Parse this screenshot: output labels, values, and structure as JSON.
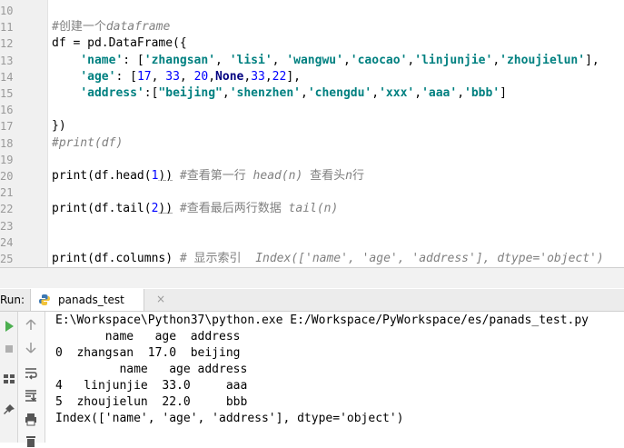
{
  "editor": {
    "lines": [
      {
        "n": "10",
        "segs": []
      },
      {
        "n": "11",
        "segs": [
          {
            "t": "#创建一个",
            "c": "cmn"
          },
          {
            "t": "dataframe",
            "c": "cm"
          }
        ]
      },
      {
        "n": "12",
        "segs": [
          {
            "t": "df = pd.DataFrame({",
            "c": ""
          }
        ]
      },
      {
        "n": "13",
        "segs": [
          {
            "t": "    ",
            "c": ""
          },
          {
            "t": "'name'",
            "c": "key"
          },
          {
            "t": ": [",
            "c": ""
          },
          {
            "t": "'zhangsan'",
            "c": "str"
          },
          {
            "t": ", ",
            "c": ""
          },
          {
            "t": "'lisi'",
            "c": "str"
          },
          {
            "t": ", ",
            "c": ""
          },
          {
            "t": "'wangwu'",
            "c": "str"
          },
          {
            "t": ",",
            "c": ""
          },
          {
            "t": "'caocao'",
            "c": "str"
          },
          {
            "t": ",",
            "c": ""
          },
          {
            "t": "'linjunjie'",
            "c": "str"
          },
          {
            "t": ",",
            "c": ""
          },
          {
            "t": "'zhoujielun'",
            "c": "str"
          },
          {
            "t": "],",
            "c": ""
          }
        ]
      },
      {
        "n": "14",
        "segs": [
          {
            "t": "    ",
            "c": ""
          },
          {
            "t": "'age'",
            "c": "key"
          },
          {
            "t": ": [",
            "c": ""
          },
          {
            "t": "17",
            "c": "num"
          },
          {
            "t": ", ",
            "c": ""
          },
          {
            "t": "33",
            "c": "num"
          },
          {
            "t": ", ",
            "c": ""
          },
          {
            "t": "20",
            "c": "num"
          },
          {
            "t": ",",
            "c": ""
          },
          {
            "t": "None",
            "c": "kw"
          },
          {
            "t": ",",
            "c": ""
          },
          {
            "t": "33",
            "c": "num"
          },
          {
            "t": ",",
            "c": ""
          },
          {
            "t": "22",
            "c": "num"
          },
          {
            "t": "],",
            "c": ""
          }
        ]
      },
      {
        "n": "15",
        "segs": [
          {
            "t": "    ",
            "c": ""
          },
          {
            "t": "'address'",
            "c": "key"
          },
          {
            "t": ":[",
            "c": ""
          },
          {
            "t": "\"beijing\"",
            "c": "str"
          },
          {
            "t": ",",
            "c": ""
          },
          {
            "t": "'shenzhen'",
            "c": "str"
          },
          {
            "t": ",",
            "c": ""
          },
          {
            "t": "'chengdu'",
            "c": "str"
          },
          {
            "t": ",",
            "c": ""
          },
          {
            "t": "'xxx'",
            "c": "str"
          },
          {
            "t": ",",
            "c": ""
          },
          {
            "t": "'aaa'",
            "c": "str"
          },
          {
            "t": ",",
            "c": ""
          },
          {
            "t": "'bbb'",
            "c": "str"
          },
          {
            "t": "]",
            "c": ""
          }
        ]
      },
      {
        "n": "16",
        "segs": []
      },
      {
        "n": "17",
        "segs": [
          {
            "t": "})",
            "c": ""
          }
        ]
      },
      {
        "n": "18",
        "segs": [
          {
            "t": "#print(df)",
            "c": "cm"
          }
        ]
      },
      {
        "n": "19",
        "segs": []
      },
      {
        "n": "20",
        "segs": [
          {
            "t": "print(df.head(",
            "c": ""
          },
          {
            "t": "1",
            "c": "num"
          },
          {
            "t": "))",
            "c": "paren-hl"
          },
          {
            "t": " #查看第一行 ",
            "c": "cmn"
          },
          {
            "t": "head(n)",
            "c": "cm"
          },
          {
            "t": " 查看头",
            "c": "cmn"
          },
          {
            "t": "n",
            "c": "cm"
          },
          {
            "t": "行",
            "c": "cmn"
          }
        ]
      },
      {
        "n": "21",
        "segs": []
      },
      {
        "n": "22",
        "segs": [
          {
            "t": "print(df.tail(",
            "c": ""
          },
          {
            "t": "2",
            "c": "num"
          },
          {
            "t": "))",
            "c": "paren-hl"
          },
          {
            "t": " #查看最后两行数据 ",
            "c": "cmn"
          },
          {
            "t": "tail(n)",
            "c": "cm"
          }
        ]
      },
      {
        "n": "23",
        "segs": []
      },
      {
        "n": "24",
        "segs": []
      },
      {
        "n": "25",
        "segs": [
          {
            "t": "print(df.columns)",
            "c": ""
          },
          {
            "t": " # 显示索引  ",
            "c": "cmn"
          },
          {
            "t": "Index(['name', 'age', 'address'], dtype='object')",
            "c": "cm"
          }
        ]
      }
    ]
  },
  "run_panel": {
    "label": "Run:",
    "tab_title": "panads_test",
    "tab_close": "×",
    "console_lines": [
      "E:\\Workspace\\Python37\\python.exe E:/Workspace/PyWorkspace/es/panads_test.py",
      "       name   age  address",
      "0  zhangsan  17.0  beijing",
      "         name   age address",
      "4   linjunjie  33.0     aaa",
      "5  zhoujielun  22.0     bbb",
      "Index(['name', 'age', 'address'], dtype='object')"
    ]
  },
  "colors": {
    "keyword": "#000080",
    "string": "#008080",
    "number": "#0000ff",
    "comment": "#808080",
    "run_icon": "#4caf50"
  },
  "icons": [
    "run-icon",
    "stop-icon",
    "rerun-icon",
    "scroll-up-icon",
    "scroll-down-icon",
    "soft-wrap-icon",
    "scroll-to-end-icon",
    "print-icon",
    "pin-icon",
    "trash-icon",
    "python-icon",
    "close-icon"
  ]
}
